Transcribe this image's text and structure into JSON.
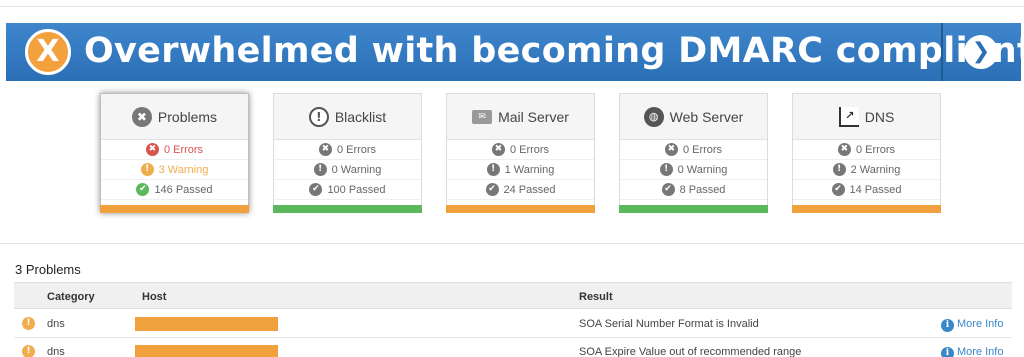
{
  "banner": {
    "x_glyph": "X",
    "text": "Overwhelmed with becoming DMARC compliant?",
    "arrow_glyph": "❯"
  },
  "cards": [
    {
      "title": "Problems",
      "icon": "x-circle-icon",
      "glyph": "✖",
      "errors": "0 Errors",
      "warnings": "3 Warning",
      "passed": "146 Passed",
      "bar_color": "#f0a03c"
    },
    {
      "title": "Blacklist",
      "icon": "exclamation-circle-icon",
      "glyph": "!",
      "errors": "0 Errors",
      "warnings": "0 Warning",
      "passed": "100 Passed",
      "bar_color": "#5cb85c"
    },
    {
      "title": "Mail Server",
      "icon": "envelope-icon",
      "glyph": "✉",
      "errors": "0 Errors",
      "warnings": "1 Warning",
      "passed": "24 Passed",
      "bar_color": "#f0a03c"
    },
    {
      "title": "Web Server",
      "icon": "globe-icon",
      "glyph": "◍",
      "errors": "0 Errors",
      "warnings": "0 Warning",
      "passed": "8 Passed",
      "bar_color": "#5cb85c"
    },
    {
      "title": "DNS",
      "icon": "chart-icon",
      "glyph": "↗",
      "errors": "0 Errors",
      "warnings": "2 Warning",
      "passed": "14 Passed",
      "bar_color": "#f0a03c"
    }
  ],
  "glyphs": {
    "error": "✖",
    "warning": "!",
    "passed": "✔",
    "info": "i"
  },
  "problems": {
    "title": "3 Problems",
    "columns": [
      "Category",
      "Host",
      "Result"
    ],
    "rows": [
      {
        "category": "dns",
        "result": "SOA Serial Number Format is Invalid",
        "link": "More Info"
      },
      {
        "category": "dns",
        "result": "SOA Expire Value out of recommended range",
        "link": "More Info"
      }
    ]
  },
  "colors": {
    "accent": "#2b6fb6",
    "warning": "#f0a03c",
    "ok": "#5cb85c",
    "error": "#d9534f"
  }
}
